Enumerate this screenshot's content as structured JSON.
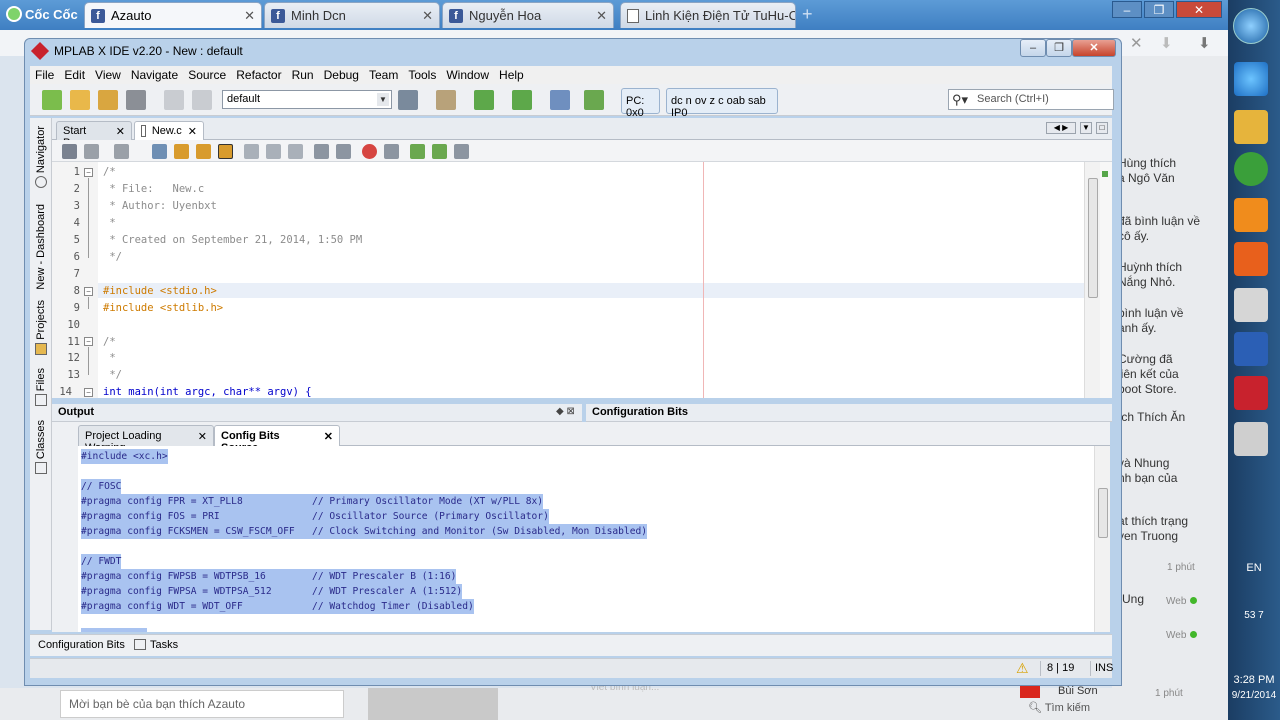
{
  "browser": {
    "brand": "Cốc Cốc",
    "tabs": [
      {
        "label": "Azauto",
        "active": true
      },
      {
        "label": "Minh Dcn",
        "active": false
      },
      {
        "label": "Nguyễn Hoa",
        "active": false
      },
      {
        "label": "Linh Kiện Điện Tử TuHu-C",
        "active": false
      }
    ]
  },
  "facebook": {
    "feed": [
      "Hùng thích\na Ngô Văn",
      "đã bình luận về\ncô ấy.",
      "Huỳnh thích\nNắng Nhỏ.",
      "bình luận về\nanh ấy.",
      "Cường đã\nliên kết của\nboot Store.",
      "ích Thích Ăn",
      "và Nhung\nnh bạn của",
      "at thích trạng\nyen Truong"
    ],
    "time_1": "1 phút",
    "user_1": "Ung",
    "web_label": "Web",
    "invite_text": "Mời bạn bè của bạn thích Azauto",
    "bottom_name": "Bùi Sơn",
    "bottom_time": "1 phút",
    "search_label": "Tìm kiếm",
    "post_placeholder": "Viết bình luận..."
  },
  "taskbar": {
    "lang": "EN",
    "nums": "53  7",
    "time": "3:28 PM",
    "date": "9/21/2014"
  },
  "ide": {
    "title": "MPLAB X IDE v2.20 - New : default",
    "menu": [
      "File",
      "Edit",
      "View",
      "Navigate",
      "Source",
      "Refactor",
      "Run",
      "Debug",
      "Team",
      "Tools",
      "Window",
      "Help"
    ],
    "config": "default",
    "pc": "PC: 0x0",
    "status_flags": "dc n ov z c oab sab IP0",
    "search_placeholder": "Search (Ctrl+I)",
    "side_tabs": [
      "Navigator",
      "New - Dashboard",
      "Projects",
      "Files",
      "Classes"
    ],
    "editor_tabs": [
      {
        "label": "Start Page",
        "active": false
      },
      {
        "label": "New.c",
        "active": true
      }
    ],
    "code_lines": [
      {
        "n": "1",
        "t": "/*"
      },
      {
        "n": "2",
        "t": " * File:   New.c"
      },
      {
        "n": "3",
        "t": " * Author: Uyenbxt"
      },
      {
        "n": "4",
        "t": " *"
      },
      {
        "n": "5",
        "t": " * Created on September 21, 2014, 1:50 PM"
      },
      {
        "n": "6",
        "t": " */"
      },
      {
        "n": "7",
        "t": ""
      },
      {
        "n": "8",
        "t": "#include <stdio.h>"
      },
      {
        "n": "9",
        "t": "#include <stdlib.h>"
      },
      {
        "n": "10",
        "t": ""
      },
      {
        "n": "11",
        "t": "/*"
      },
      {
        "n": "12",
        "t": " *"
      },
      {
        "n": "13",
        "t": " */"
      },
      {
        "n": "14",
        "t": "int main(int argc, char** argv) {"
      }
    ],
    "output_title": "Output",
    "config_bits_title": "Configuration Bits",
    "output_tabs": [
      {
        "label": "Project Loading Warning",
        "active": false
      },
      {
        "label": "Config Bits Source",
        "active": true
      }
    ],
    "output_lines": [
      "#include <xc.h>",
      "",
      "// FOSC",
      "#pragma config FPR = XT_PLL8            // Primary Oscillator Mode (XT w/PLL 8x)",
      "#pragma config FOS = PRI                // Oscillator Source (Primary Oscillator)",
      "#pragma config FCKSMEN = CSW_FSCM_OFF   // Clock Switching and Monitor (Sw Disabled, Mon Disabled)",
      "",
      "// FWDT",
      "#pragma config FWPSB = WDTPSB_16        // WDT Prescaler B (1:16)",
      "#pragma config FWPSA = WDTPSA_512       // WDT Prescaler A (1:512)",
      "#pragma config WDT = WDT_OFF            // Watchdog Timer (Disabled)"
    ],
    "bottom_tabs": [
      "Configuration Bits",
      "Tasks"
    ],
    "caret_pos": "8 | 19",
    "insert_mode": "INS"
  }
}
